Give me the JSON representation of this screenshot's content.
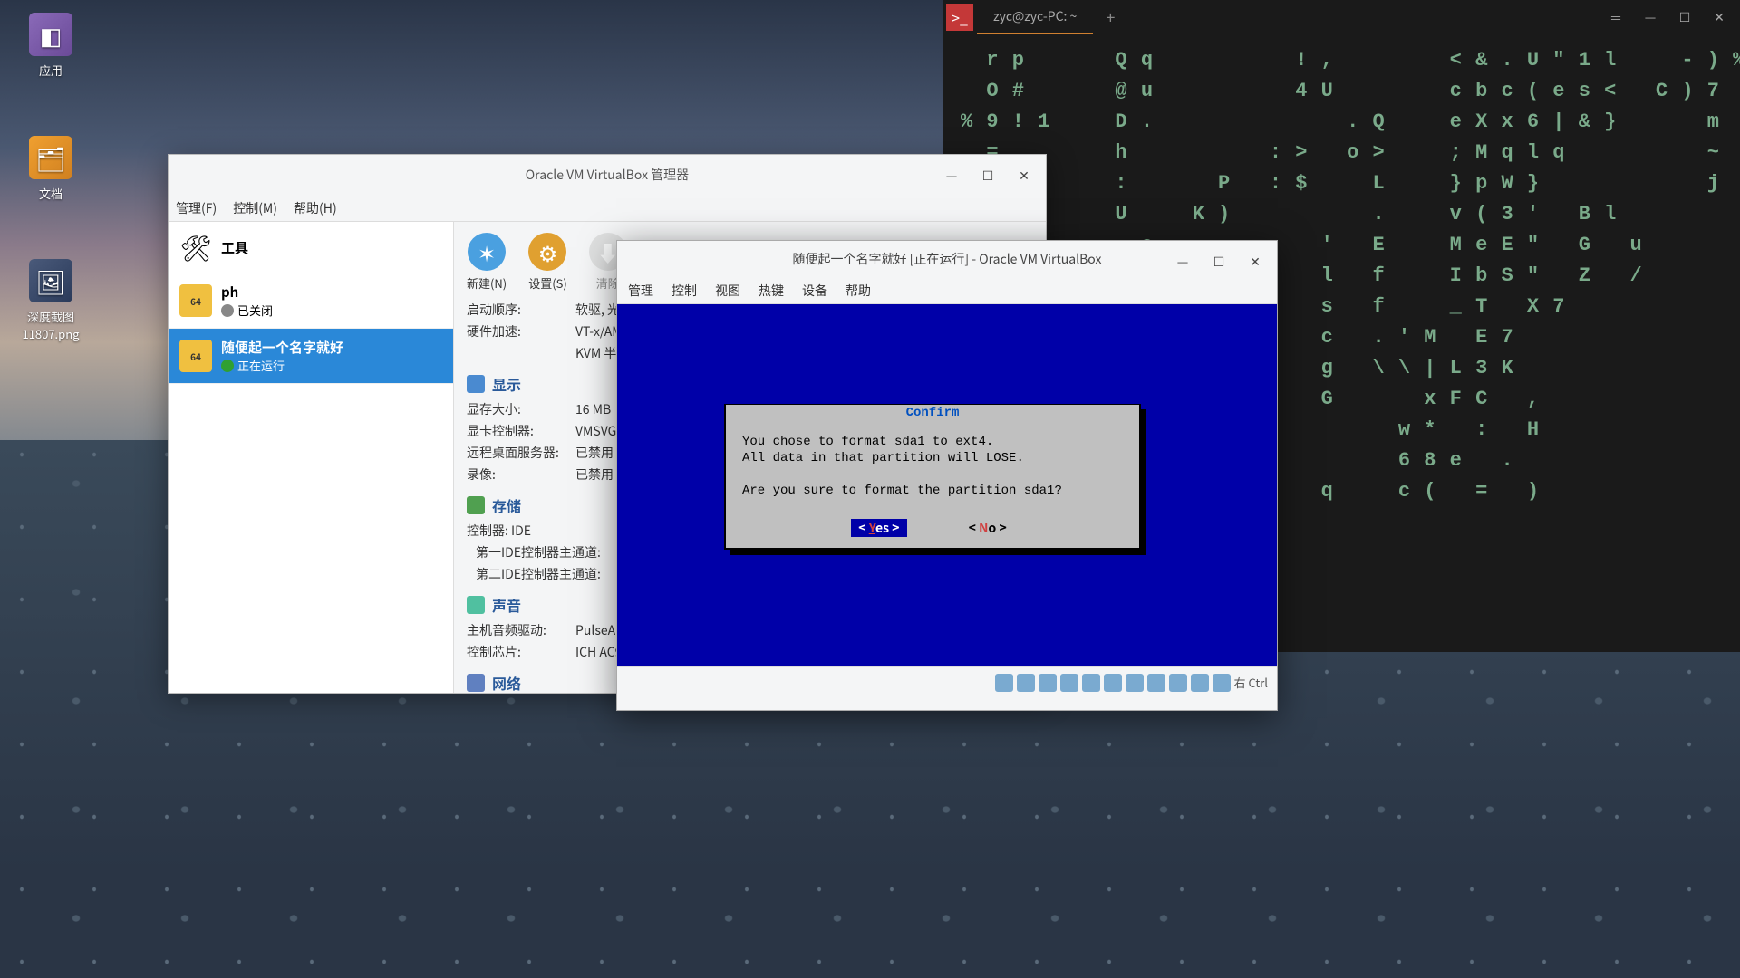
{
  "desktop": {
    "icons": [
      {
        "label": "应用"
      },
      {
        "label": "文档"
      },
      {
        "label": "深度截图\n11807.png"
      }
    ]
  },
  "terminal": {
    "tab_title": "zyc@zyc-PC: ~",
    "matrix": "  r p       Q q           ! ,         < & . U \" 1 l     - ) %\n  O #       @ u           4 U         c b c ( e s <   C ) 7\n% 9 ! 1     D .               . Q     e X x 6 | & }       m\n  =         h           : >   o >     ; M q l q           ~\n  8         :       P   : $     L     } p W }             j\n            U     K )           .     v ( 3 '   B l\n  *         , e             '   E     M e E \"   G   u\n  F   9     =               l   f     I b S \"   Z   /\n      #   a         B       s   f     _ T   X 7\n{ M         |       R       c   . ' M   E 7\n                    J       g   \\ \\ | L 3 K\n  h         :               G       x F C   ,\n                    W             w *   :   H\n  t         4                     6 8 e   .\n            @     J t       q     c (   =   )"
  },
  "vbox_manager": {
    "title": "Oracle VM VirtualBox 管理器",
    "menu": {
      "file": "管理(F)",
      "control": "控制(M)",
      "help": "帮助(H)"
    },
    "toolbar": {
      "new": "新建(N)",
      "settings": "设置(S)",
      "discard": "清除"
    },
    "side": {
      "tools": "工具",
      "vms": [
        {
          "name": "ph",
          "state": "已关闭"
        },
        {
          "name": "随便起一个名字就好",
          "state": "正在运行"
        }
      ]
    },
    "details": {
      "general": {
        "boot_k": "启动顺序:",
        "boot_v": "软驱, 光驱, 硬",
        "accel_k": "硬件加速:",
        "accel_v": "VT-x/AMD-V, 嵌",
        "accel_v2": "KVM 半虚拟化"
      },
      "display": {
        "h": "显示",
        "vram_k": "显存大小:",
        "vram_v": "16 MB",
        "gfx_k": "显卡控制器:",
        "gfx_v": "VMSVG",
        "rdp_k": "远程桌面服务器:",
        "rdp_v": "已禁用",
        "rec_k": "录像:",
        "rec_v": "已禁用"
      },
      "storage": {
        "h": "存储",
        "ctrl": "控制器: IDE",
        "p1": "第一IDE控制器主通道:",
        "p2": "第二IDE控制器主通道:"
      },
      "audio": {
        "h": "声音",
        "drv_k": "主机音频驱动:",
        "drv_v": "PulseAu",
        "chip_k": "控制芯片:",
        "chip_v": "ICH AC97"
      },
      "network": {
        "h": "网络"
      }
    }
  },
  "vm_window": {
    "title": "随便起一个名字就好 [正在运行] - Oracle VM VirtualBox",
    "menu": [
      "管理",
      "控制",
      "视图",
      "热键",
      "设备",
      "帮助"
    ],
    "dialog": {
      "title": "Confirm",
      "body": "You chose to format sda1 to ext4.\nAll data in that partition will LOSE.\n\nAre you sure to format the partition sda1?",
      "yes": "Yes",
      "no": "No"
    },
    "host_key": "右 Ctrl"
  }
}
